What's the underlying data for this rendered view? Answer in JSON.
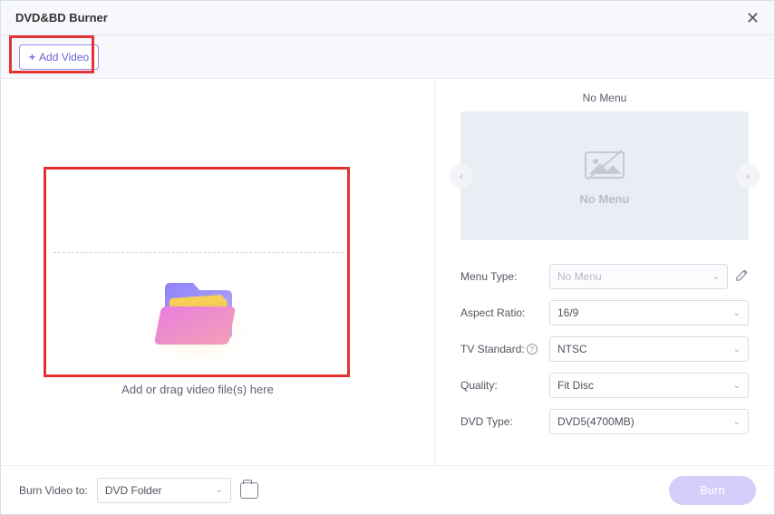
{
  "window": {
    "title": "DVD&BD Burner"
  },
  "toolbar": {
    "add_video_label": "Add Video"
  },
  "drop": {
    "label": "Add or drag video file(s) here"
  },
  "preview": {
    "title": "No Menu",
    "placeholder_text": "No Menu"
  },
  "form": {
    "menu_type": {
      "label": "Menu Type:",
      "value": "No Menu"
    },
    "aspect_ratio": {
      "label": "Aspect Ratio:",
      "value": "16/9"
    },
    "tv_standard": {
      "label": "TV Standard:",
      "value": "NTSC"
    },
    "quality": {
      "label": "Quality:",
      "value": "Fit Disc"
    },
    "dvd_type": {
      "label": "DVD Type:",
      "value": "DVD5(4700MB)"
    }
  },
  "footer": {
    "burn_to_label": "Burn Video to:",
    "burn_to_value": "DVD Folder",
    "burn_label": "Burn"
  }
}
